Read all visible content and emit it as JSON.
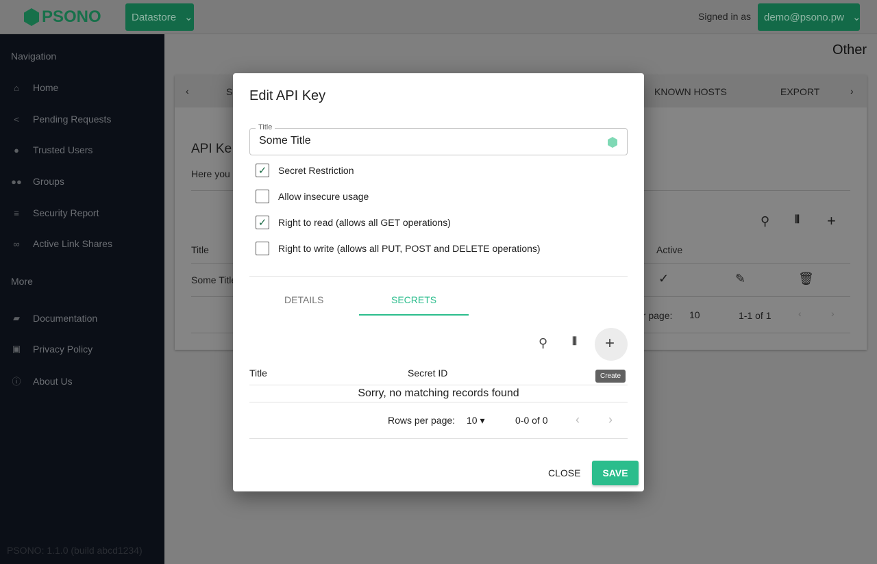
{
  "header": {
    "logo": "PSONO",
    "datastore_label": "Datastore",
    "signed_in_label": "Signed in as",
    "user": "demo@psono.pw"
  },
  "sidebar": {
    "nav_heading": "Navigation",
    "items": [
      {
        "label": "Home",
        "icon": "home-icon"
      },
      {
        "label": "Pending Requests",
        "icon": "share-icon"
      },
      {
        "label": "Trusted Users",
        "icon": "person-icon"
      },
      {
        "label": "Groups",
        "icon": "groups-icon"
      },
      {
        "label": "Security Report",
        "icon": "checklist-icon"
      },
      {
        "label": "Active Link Shares",
        "icon": "link-icon"
      }
    ],
    "more_heading": "More",
    "more_items": [
      {
        "label": "Documentation",
        "icon": "book-icon"
      },
      {
        "label": "Privacy Policy",
        "icon": "lock-icon"
      },
      {
        "label": "About Us",
        "icon": "info-icon"
      }
    ],
    "version": "PSONO: 1.1.0 (build abcd1234)"
  },
  "page": {
    "title": "Other",
    "tabs": [
      "S",
      "KNOWN HOSTS",
      "EXPORT"
    ],
    "section_title": "API Ke",
    "desc": "Here you",
    "col_title": "Title",
    "col_active": "Active",
    "row_title": "Some Title",
    "rows_per_page": "er page:",
    "rpp_value": "10",
    "range": "1-1 of 1"
  },
  "modal": {
    "title": "Edit API Key",
    "field_label": "Title",
    "field_value": "Some Title",
    "checkboxes": [
      {
        "label": "Secret Restriction",
        "checked": true
      },
      {
        "label": "Allow insecure usage",
        "checked": false
      },
      {
        "label": "Right to read (allows all GET operations)",
        "checked": true
      },
      {
        "label": "Right to write (allows all PUT, POST and DELETE operations)",
        "checked": false
      }
    ],
    "tabs": [
      {
        "label": "DETAILS",
        "active": false
      },
      {
        "label": "SECRETS",
        "active": true
      }
    ],
    "col_title": "Title",
    "col_secret_id": "Secret ID",
    "empty": "Sorry, no matching records found",
    "tooltip": "Create",
    "rows_per_page": "Rows per page:",
    "rpp_value": "10",
    "range": "0-0 of 0",
    "close": "CLOSE",
    "save": "SAVE"
  },
  "colors": {
    "accent": "#2bbd8c",
    "sidebar": "#0b0f17"
  }
}
